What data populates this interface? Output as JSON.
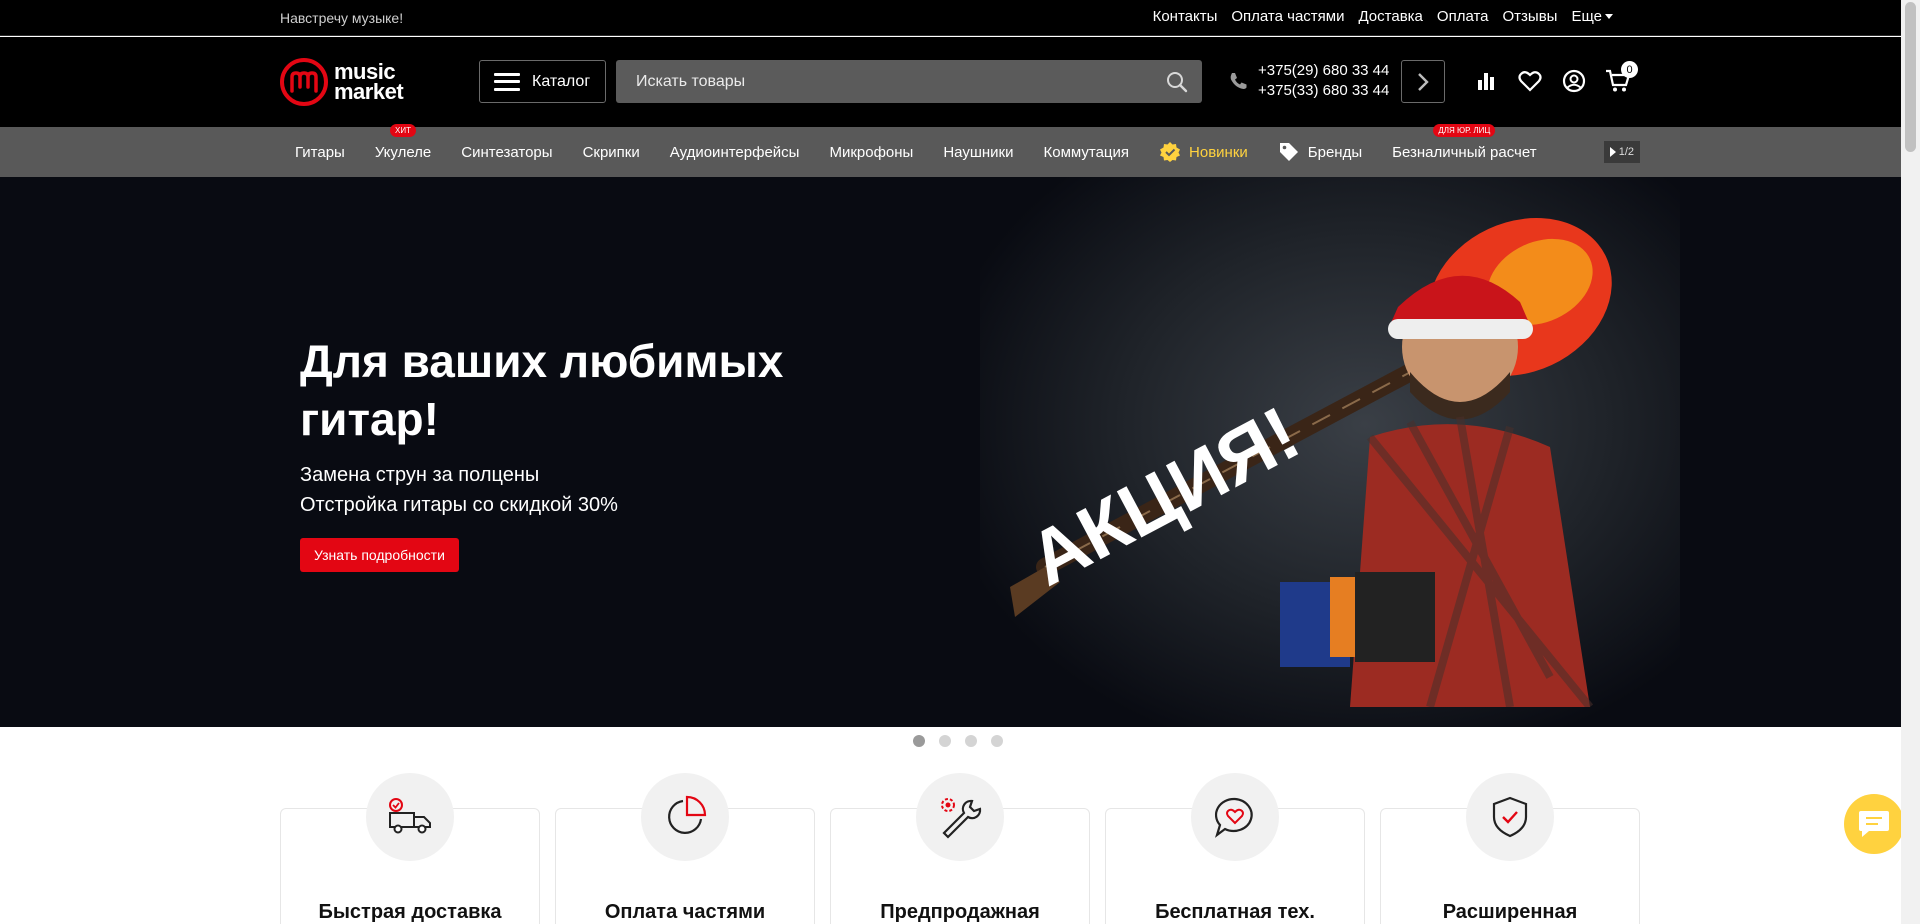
{
  "topbar": {
    "tagline": "Навстречу музыке!",
    "links": [
      "Контакты",
      "Оплата частями",
      "Доставка",
      "Оплата",
      "Отзывы"
    ],
    "more_label": "Еще"
  },
  "header": {
    "logo_line1": "music",
    "logo_line2": "market",
    "catalog_label": "Каталог",
    "search_placeholder": "Искать товары",
    "phone1": "+375(29) 680 33 44",
    "phone2": "+375(33) 680 33 44",
    "cart_count": "0"
  },
  "nav": {
    "items": [
      {
        "label": "Гитары",
        "badge": ""
      },
      {
        "label": "Укулеле",
        "badge": "ХИТ"
      },
      {
        "label": "Синтезаторы",
        "badge": ""
      },
      {
        "label": "Скрипки",
        "badge": ""
      },
      {
        "label": "Аудиоинтерфейсы",
        "badge": ""
      },
      {
        "label": "Микрофоны",
        "badge": ""
      },
      {
        "label": "Наушники",
        "badge": ""
      },
      {
        "label": "Коммутация",
        "badge": ""
      },
      {
        "label": "Новинки",
        "badge": ""
      },
      {
        "label": "Бренды",
        "badge": ""
      },
      {
        "label": "Безналичный расчет",
        "badge": "ДЛЯ ЮР. ЛИЦ"
      }
    ],
    "pager": "1/2"
  },
  "hero": {
    "title": "Для ваших любимых гитар!",
    "line1": "Замена струн за полцены",
    "line2": "Отстройка гитары со скидкой 30%",
    "button": "Узнать подробности",
    "promo_text": "АКЦИЯ!",
    "slides_total": 4,
    "active_slide": 1
  },
  "features": [
    {
      "title": "Быстрая доставка",
      "icon": "delivery-truck-icon"
    },
    {
      "title": "Оплата частями",
      "icon": "pie-chart-icon"
    },
    {
      "title": "Предпродажная",
      "icon": "wrench-gear-icon"
    },
    {
      "title": "Бесплатная тех.",
      "icon": "chat-heart-icon"
    },
    {
      "title": "Расширенная",
      "icon": "shield-check-icon"
    }
  ],
  "colors": {
    "accent": "#e30613",
    "highlight": "#ffd23f",
    "nav_bg": "#595959",
    "header_bg": "#000000"
  }
}
